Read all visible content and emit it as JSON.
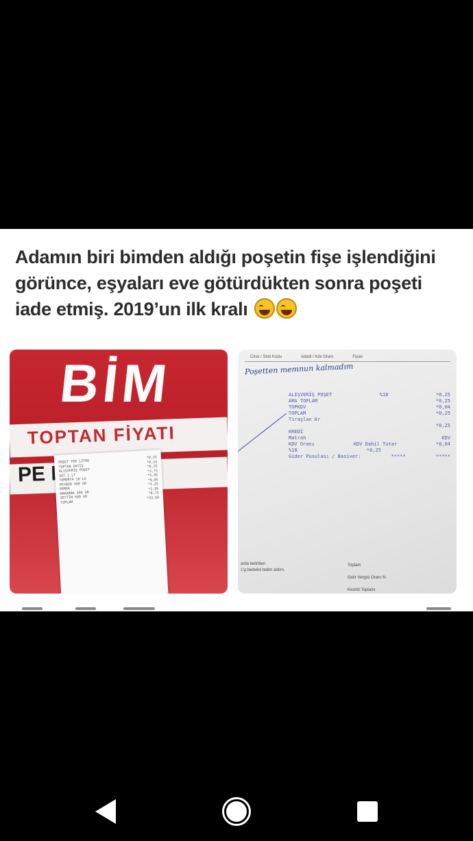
{
  "post": {
    "caption_lines": [
      "Adamın biri bimden aldığı poşetin fişe işlendiğini",
      "görünce, eşyaları eve götürdükten sonra poşeti",
      "iade etmiş. 2019’un ilk kralı"
    ],
    "emojis": [
      "grinning-sweat-face",
      "grinning-sweat-face"
    ]
  },
  "left_photo": {
    "logo": "BİM",
    "band_line_1": "TOPTAN FİYATI",
    "band_line_2": "PE                DE SA",
    "receipt_lines": [
      [
        "POŞET TEK LİTRE",
        "*0,25"
      ],
      [
        "TOPTAN SATIŞ",
        "*0,25"
      ],
      [
        "ALIŞVERİŞ POŞET",
        "*0,25"
      ],
      [
        "SÜT 1 LT",
        "*3,75"
      ],
      [
        "YUMURTA 10'LU",
        "*5,95"
      ],
      [
        "PEYNİR 500 GR",
        "*9,95"
      ],
      [
        "EKMEK",
        "*1,25"
      ],
      [
        "MAKARNA 500 GR",
        "*1,95"
      ],
      [
        "ZEYTİN 500 GR",
        "*8,75"
      ],
      [
        "TOPLAM",
        "*33,40"
      ]
    ]
  },
  "right_photo": {
    "header_cols": [
      "Cinsi / Stok Kodu",
      "Adedi / Kdv Oranı",
      "Fiyatı"
    ],
    "handwriting": "Poşetten memnun kalmadım",
    "receipt_lines": [
      [
        "ALIŞVERİŞ POŞET",
        "%18",
        "*0,25"
      ],
      [
        "ARA TOPLAM",
        "",
        "*0,25"
      ],
      [
        "TOPKDV",
        "",
        "*0,04"
      ],
      [
        "TOPLAM",
        "",
        "*0,25"
      ],
      [
        "Tiraşlan Kr",
        "",
        ""
      ],
      [
        "",
        "",
        "*0,25"
      ],
      [
        "KREDİ",
        "",
        ""
      ],
      [
        "Matrah",
        "",
        "KDV"
      ],
      [
        "KDV Oranı",
        "KDV Dahil Tutar",
        "*0,04"
      ],
      [
        "%18",
        "*0,25",
        ""
      ],
      [
        "",
        "",
        ""
      ],
      [
        "Gider Pusulası / Basiver:",
        "*****",
        "*****"
      ]
    ],
    "footer_left_1": "arda belirtilen",
    "footer_left_2": "1'g bedelini tedim aldım.",
    "footer_right_1": "Toplam",
    "footer_right_2": "Gelir Vergisi Oranı %",
    "footer_right_3": "Kesinti Toplamı"
  },
  "nav": {
    "back": "back-icon",
    "home": "home-icon",
    "recents": "recents-icon"
  }
}
